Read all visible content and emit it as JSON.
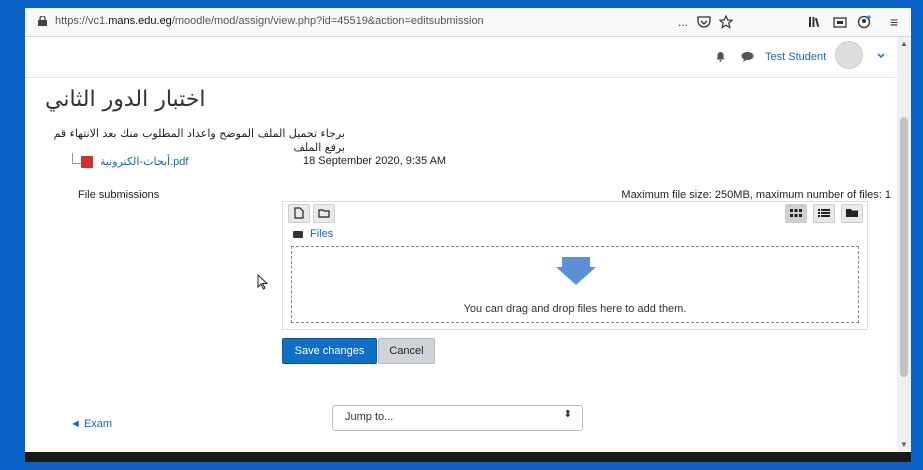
{
  "browser": {
    "url_prefix": "https://vc1.",
    "url_domain": "mans.edu.eg",
    "url_path": "/moodle/mod/assign/view.php?id=45519&action=editsubmission",
    "more_icon": "...",
    "pocket_icon": "pocket-icon",
    "star_icon": "star-icon",
    "library_icon": "library-icon",
    "tabs_icon": "tabs-icon",
    "account_icon": "account-icon",
    "menu_icon": "≡"
  },
  "header": {
    "user_name": "Test Student"
  },
  "assignment": {
    "title": "اختبار الدور الثاني",
    "intro": "برجاء تحميل الملف الموضح واعداد المطلوب منك بعد الانتهاء قم برفع الملف",
    "file_name": "أبحاث-الكترونية.pdf",
    "file_date": "18 September 2020, 9:35 AM"
  },
  "submission": {
    "label": "File submissions",
    "limit": "Maximum file size: 250MB, maximum number of files: 1",
    "path_label": "Files",
    "drop_text": "You can drag and drop files here to add them."
  },
  "actions": {
    "save": "Save changes",
    "cancel": "Cancel"
  },
  "footer": {
    "exam_link": "Exam",
    "jump_placeholder": "Jump to..."
  },
  "colors": {
    "brand": "#0f6fc5",
    "frame_bg": "#0b63c9",
    "pdf": "#d32f2f"
  }
}
